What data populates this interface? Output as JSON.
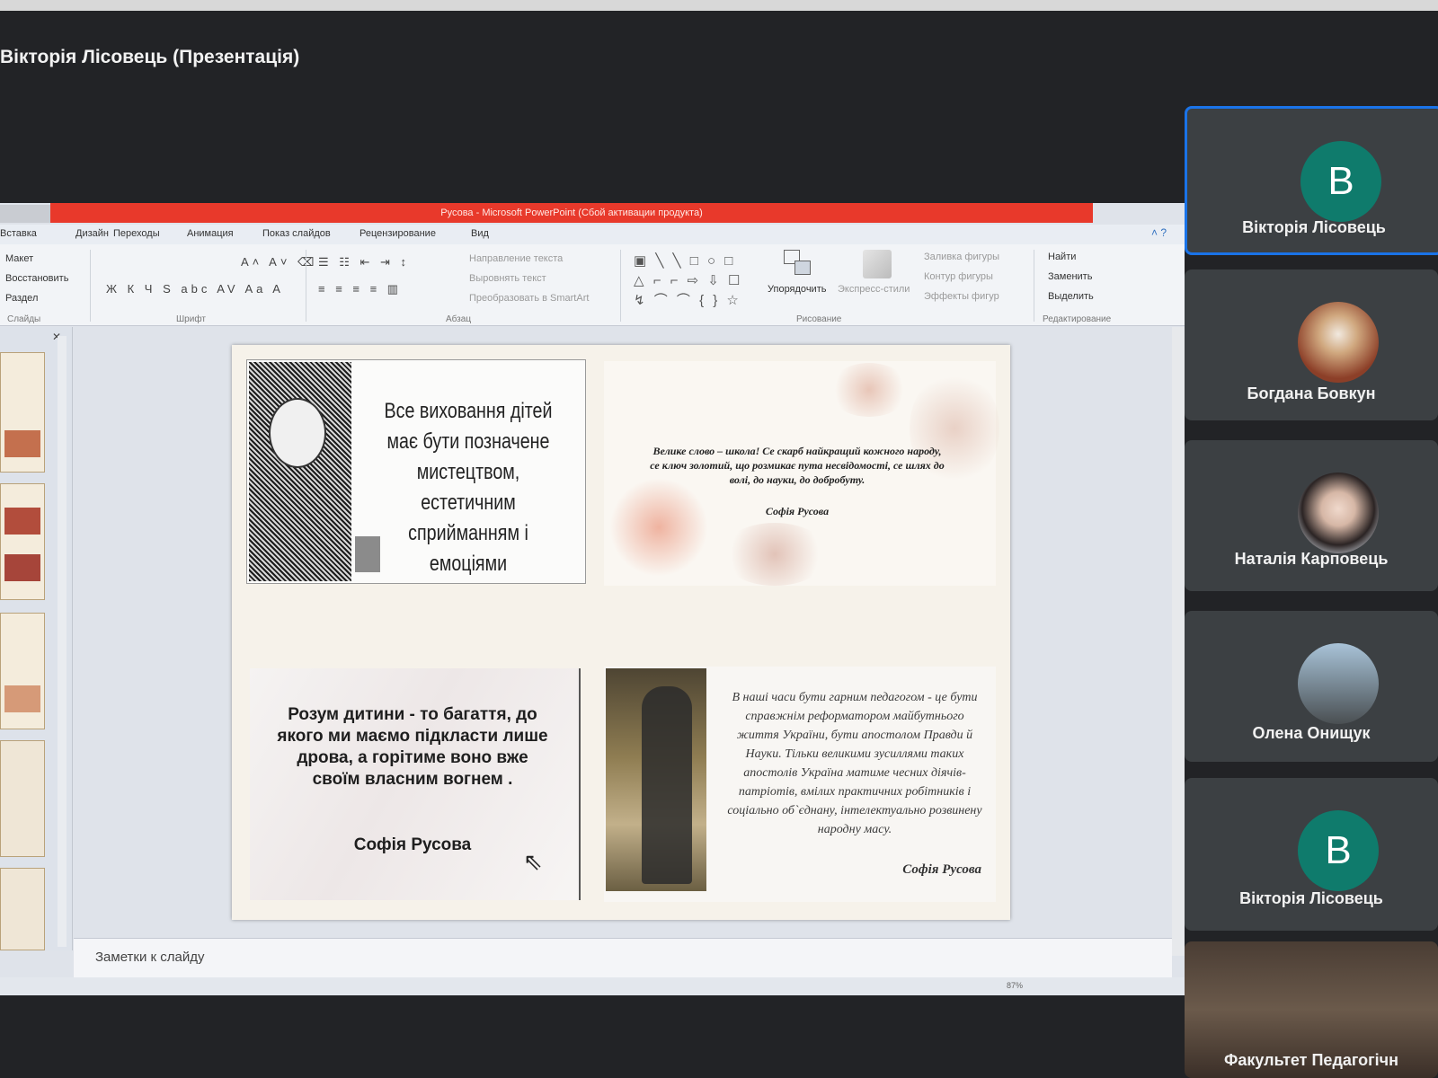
{
  "meeting": {
    "title": "Вікторія Лісовець (Презентація)"
  },
  "powerpoint": {
    "window_title": "Русова  -  Microsoft PowerPoint (Сбой активации продукта)",
    "menu": [
      "Вставка",
      "Дизайн",
      "Переходы",
      "Анимация",
      "Показ слайдов",
      "Рецензирование",
      "Вид"
    ],
    "ribbon": {
      "slides_group": {
        "label": "Слайды",
        "items": [
          "Макет",
          "Восстановить",
          "Раздел"
        ]
      },
      "font_group": {
        "label": "Шрифт"
      },
      "paragraph_group": {
        "label": "Абзац",
        "items": [
          "Направление текста",
          "Выровнять текст",
          "Преобразовать в SmartArt"
        ]
      },
      "drawing_group": {
        "label": "Рисование",
        "arrange": "Упорядочить",
        "quick_styles": "Экспресс-стили",
        "items": [
          "Заливка фигуры",
          "Контур фигуры",
          "Эффекты фигур"
        ]
      },
      "editing_group": {
        "label": "Редактирование",
        "items": [
          "Найти",
          "Заменить",
          "Выделить"
        ]
      }
    },
    "notes_placeholder": "Заметки к слайду",
    "zoom": "87%"
  },
  "slide": {
    "quote1": "Все виховання дітей має бути позначене мистецтвом, естетичним сприйманням і емоціями",
    "quote2": "Велике слово – школа! Се скарб найкращий кожного народу, се ключ золотий, що розмикає пута несвідомості, се шлях до волі, до науки, до добробуту.",
    "quote2_author": "Софія Русова",
    "quote3": "Розум дитини - то багаття, до якого ми маємо підкласти лише дрова, а горітиме воно вже своїм власним вогнем .",
    "quote3_author": "Софія Русова",
    "quote4": "В наші часи бути гарним педагогом - це бути справжнім реформатором майбутнього життя України, бути апостолом Правди й Науки. Тільки великими зусиллями таких апостолів Україна матиме чесних діячів-патріотів, вмілих практичних робітників і соціально об`єднану, інтелектуально розвинену народну масу.",
    "quote4_author": "Софія Русова"
  },
  "participants": [
    {
      "name": "Вікторія Лісовець",
      "initial": "В",
      "color": "#0f7b6c"
    },
    {
      "name": "Богдана Бовкун",
      "initial": "",
      "color": "#a5533b"
    },
    {
      "name": "Наталія Карповець",
      "initial": "",
      "color": "#9aa2ad"
    },
    {
      "name": "Олена Онищук",
      "initial": "",
      "color": "#7c8fa0"
    },
    {
      "name": "Вікторія Лісовець",
      "initial": "В",
      "color": "#0f7b6c"
    },
    {
      "name": "Факультет Педагогічн",
      "initial": "",
      "color": "#5b4a3f"
    }
  ]
}
